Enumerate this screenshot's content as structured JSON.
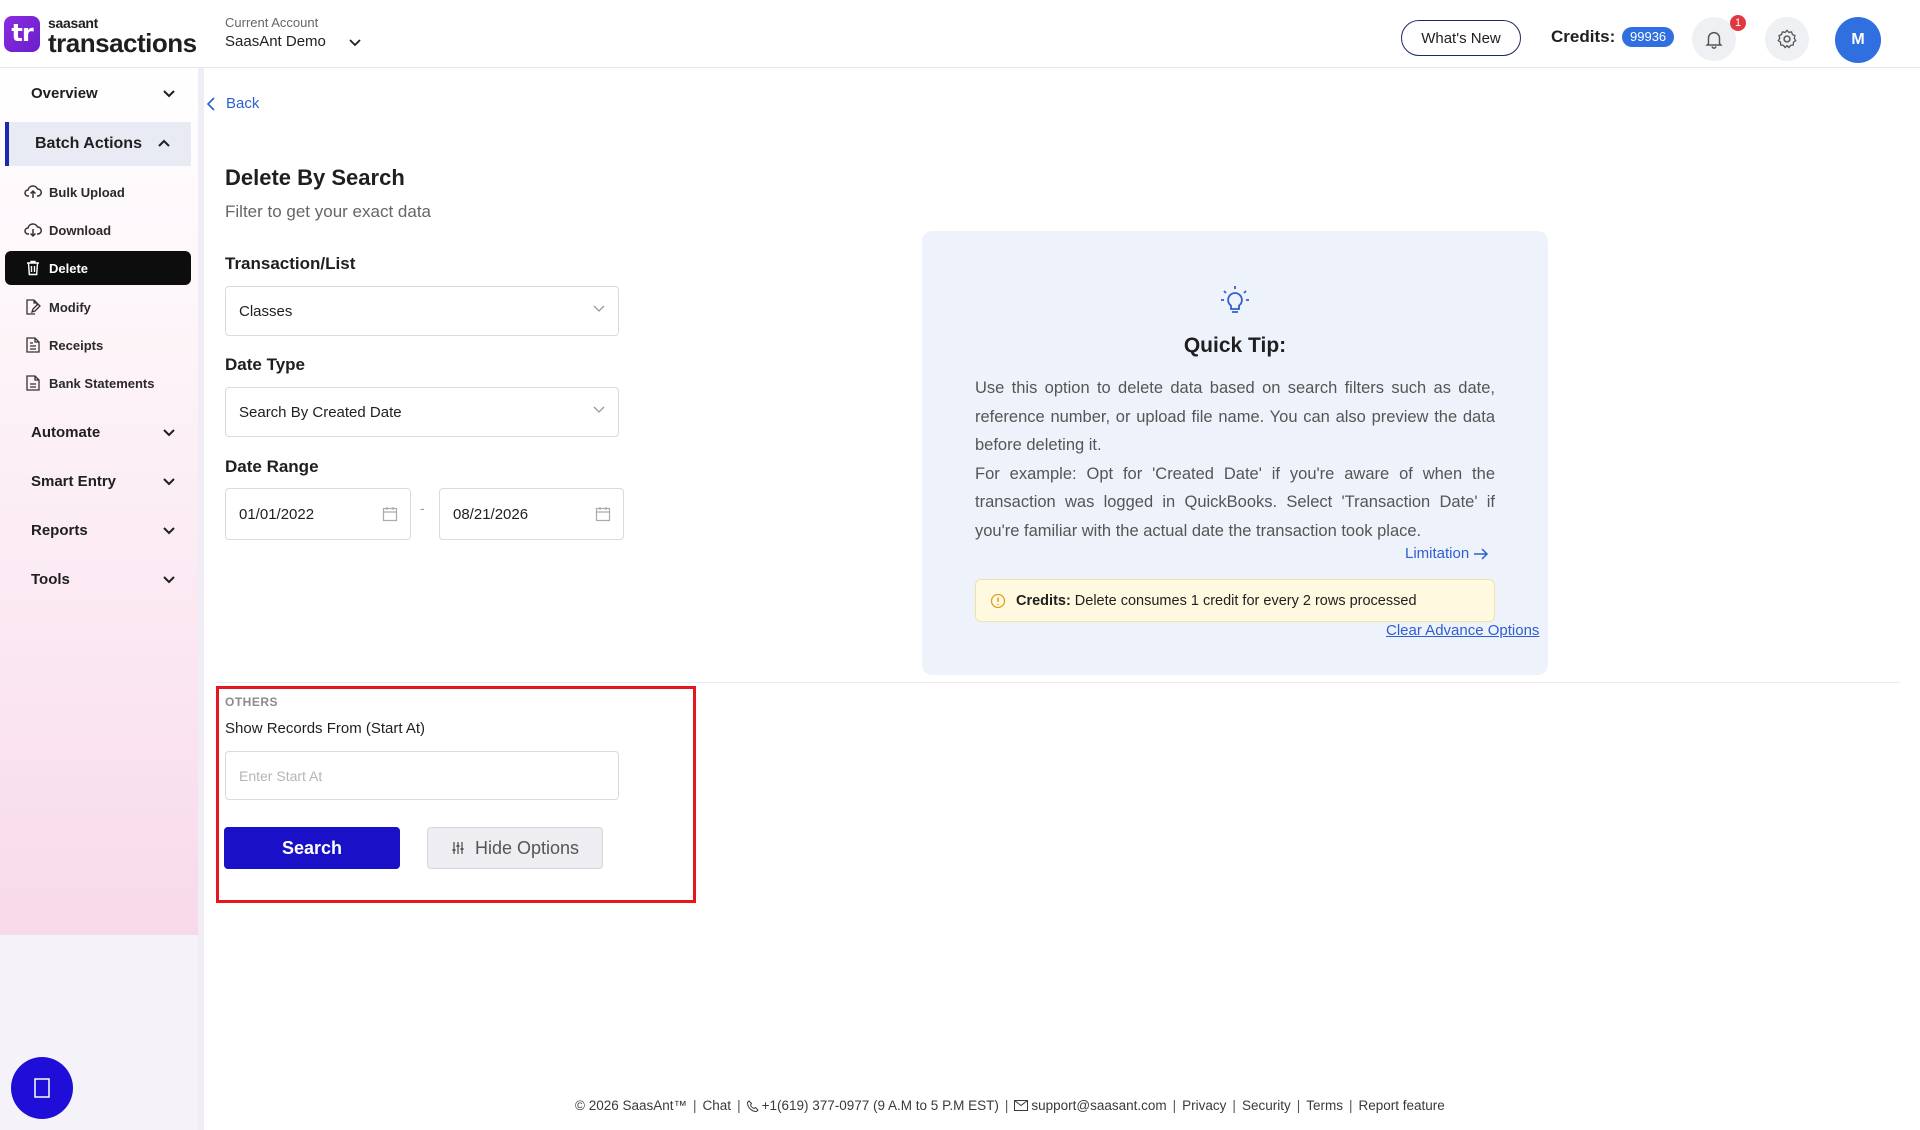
{
  "header": {
    "logo_small": "saasant",
    "logo_big": "transactions",
    "logo_badge": "tr",
    "account_label": "Current Account",
    "account_name": "SaasAnt Demo",
    "whats_new": "What's New",
    "credits_label": "Credits:",
    "credits_value": "99936",
    "notification_count": "1",
    "avatar_initial": "M"
  },
  "sidebar": {
    "overview": "Overview",
    "batch_actions": "Batch Actions",
    "items": [
      {
        "label": "Bulk Upload",
        "icon": "cloud-upload-icon"
      },
      {
        "label": "Download",
        "icon": "cloud-download-icon"
      },
      {
        "label": "Delete",
        "icon": "trash-icon"
      },
      {
        "label": "Modify",
        "icon": "edit-file-icon"
      },
      {
        "label": "Receipts",
        "icon": "receipt-icon"
      },
      {
        "label": "Bank Statements",
        "icon": "statement-icon"
      }
    ],
    "automate": "Automate",
    "smart_entry": "Smart Entry",
    "reports": "Reports",
    "tools": "Tools"
  },
  "main": {
    "back": "Back",
    "title": "Delete By Search",
    "subtitle": "Filter to get your exact data",
    "transaction_label": "Transaction/List",
    "transaction_value": "Classes",
    "date_type_label": "Date Type",
    "date_type_value": "Search By Created Date",
    "date_range_label": "Date Range",
    "date_from": "01/01/2022",
    "date_sep": "-",
    "date_to": "08/21/2026",
    "others_label": "OTHERS",
    "start_label": "Show Records From (Start At)",
    "start_placeholder": "Enter Start At",
    "search_button": "Search",
    "hide_button": "Hide Options"
  },
  "tip": {
    "title": "Quick Tip:",
    "para1": "Use this option to delete data based on search filters such as date, reference number, or upload file name. You can also preview the data before deleting it.",
    "para2": "For example: Opt for 'Created Date' if you're aware of when the transaction was logged in QuickBooks. Select 'Transaction Date' if you're familiar with the actual date the transaction took place.",
    "limitation": "Limitation",
    "credits_bold": "Credits:",
    "credits_text": "Delete consumes 1 credit for every 2 rows processed",
    "clear_advance": "Clear Advance Options"
  },
  "footer": {
    "copyright": "© 2026 SaasAnt™",
    "chat": "Chat",
    "phone": "+1(619) 377-0977 (9 A.M to 5 P.M EST)",
    "email": "support@saasant.com",
    "privacy": "Privacy",
    "security": "Security",
    "terms": "Terms",
    "report": "Report feature"
  },
  "colors": {
    "accent": "#1a10c8",
    "link": "#2f5fd0",
    "highlight": "#e5161d"
  }
}
